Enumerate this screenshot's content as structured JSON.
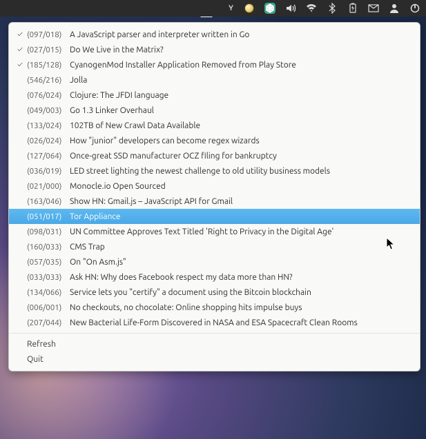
{
  "menubar": {
    "y_label": "Y"
  },
  "items": [
    {
      "checked": true,
      "counts": "(097/018)",
      "title": "A JavaScript parser and interpreter written in Go",
      "selected": false
    },
    {
      "checked": true,
      "counts": "(027/015)",
      "title": "Do We Live in the Matrix?",
      "selected": false
    },
    {
      "checked": true,
      "counts": "(185/128)",
      "title": "CyanogenMod Installer Application Removed from Play Store",
      "selected": false
    },
    {
      "checked": false,
      "counts": "(546/216)",
      "title": "Jolla",
      "selected": false
    },
    {
      "checked": false,
      "counts": "(076/024)",
      "title": "Clojure: The JFDI language",
      "selected": false
    },
    {
      "checked": false,
      "counts": "(049/003)",
      "title": "Go 1.3 Linker Overhaul",
      "selected": false
    },
    {
      "checked": false,
      "counts": "(133/024)",
      "title": "102TB of New Crawl Data Available",
      "selected": false
    },
    {
      "checked": false,
      "counts": "(026/024)",
      "title": "How \"junior\" developers can become regex wizards",
      "selected": false
    },
    {
      "checked": false,
      "counts": "(127/064)",
      "title": "Once-great SSD manufacturer OCZ filing for bankruptcy",
      "selected": false
    },
    {
      "checked": false,
      "counts": "(036/019)",
      "title": "LED street lighting the newest challenge to old utility business models",
      "selected": false
    },
    {
      "checked": false,
      "counts": "(021/000)",
      "title": "Monocle.io Open Sourced",
      "selected": false
    },
    {
      "checked": false,
      "counts": "(163/046)",
      "title": "Show HN: Gmail.js – JavaScript API for Gmail",
      "selected": false
    },
    {
      "checked": false,
      "counts": "(051/017)",
      "title": "Tor Appliance",
      "selected": true
    },
    {
      "checked": false,
      "counts": "(098/031)",
      "title": "UN Committee Approves Text Titled 'Right to Privacy in the Digital Age'",
      "selected": false
    },
    {
      "checked": false,
      "counts": "(160/033)",
      "title": "CMS Trap",
      "selected": false
    },
    {
      "checked": false,
      "counts": "(057/035)",
      "title": "On \"On Asm.js\"",
      "selected": false
    },
    {
      "checked": false,
      "counts": "(033/033)",
      "title": "Ask HN: Why does Facebook respect my data more than HN?",
      "selected": false
    },
    {
      "checked": false,
      "counts": "(134/066)",
      "title": "Service lets you \"certify\" a document using the Bitcoin blockchain",
      "selected": false
    },
    {
      "checked": false,
      "counts": "(006/001)",
      "title": "No checkouts, no chocolate: Online shopping hits impulse buys",
      "selected": false
    },
    {
      "checked": false,
      "counts": "(207/044)",
      "title": "New Bacterial Life-Form Discovered in NASA and ESA Spacecraft Clean Rooms",
      "selected": false
    }
  ],
  "actions": {
    "refresh": "Refresh",
    "quit": "Quit"
  }
}
